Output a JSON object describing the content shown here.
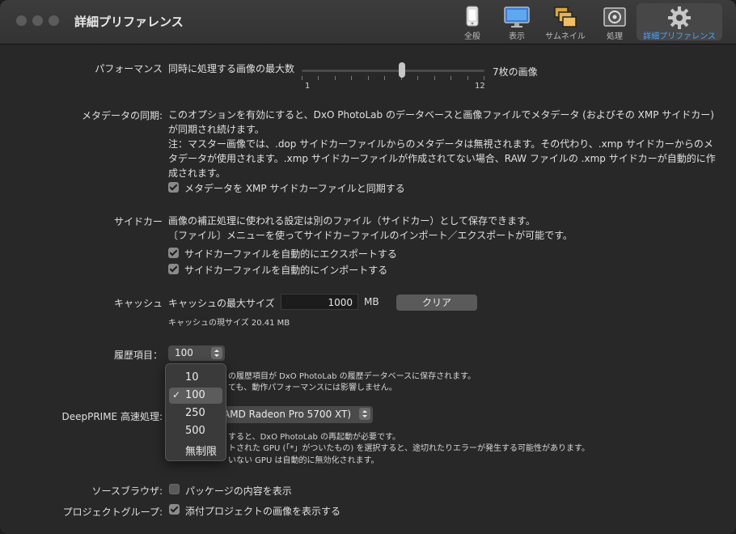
{
  "window": {
    "title": "詳細プリファレンス"
  },
  "toolbar": [
    {
      "label": "全般",
      "icon": "phone-icon"
    },
    {
      "label": "表示",
      "icon": "monitor-icon"
    },
    {
      "label": "サムネイル",
      "icon": "thumbnails-icon"
    },
    {
      "label": "処理",
      "icon": "processing-icon"
    },
    {
      "label": "詳細プリファレンス",
      "icon": "gear-icon",
      "active": true
    }
  ],
  "performance": {
    "label": "パフォーマンス",
    "desc": "同時に処理する画像の最大数",
    "min": "1",
    "max": "12",
    "value": 7,
    "value_text": "7枚の画像"
  },
  "metadata": {
    "label": "メタデータの同期:",
    "line1": "このオプションを有効にすると、DxO PhotoLab のデータベースと画像ファイルでメタデータ (およびその XMP サイドカー)",
    "line2": "が同期され続けます。",
    "note1": "注：マスター画像では、.dop サイドカーファイルからのメタデータは無視されます。その代わり、.xmp サイドカーからのメ",
    "note2": "タデータが使用されます。.xmp サイドカーファイルが作成されてない場合、RAW ファイルの .xmp サイドカーが自動的に作",
    "note3": "成されます。",
    "checkbox": {
      "label": "メタデータを XMP サイドカーファイルと同期する",
      "checked": true
    }
  },
  "sidecar": {
    "label": "サイドカー",
    "line1": "画像の補正処理に使われる設定は別のファイル（サイドカー）として保存できます。",
    "line2": "〔ファイル〕メニューを使ってサイドカ−ファイルのインポート／エクスポートが可能です。",
    "export": {
      "label": "サイドカーファイルを自動的にエクスポートする",
      "checked": true
    },
    "import": {
      "label": "サイドカーファイルを自動的にインポートする",
      "checked": true
    }
  },
  "cache": {
    "label": "キャッシュ",
    "max_label": "キャッシュの最大サイズ",
    "max_value": "1000",
    "unit": "MB",
    "clear_button": "クリア",
    "current": "キャッシュの現サイズ 20.41 MB"
  },
  "history": {
    "label": "履歴項目：",
    "value": "100",
    "desc1": "の履歴項目が DxO PhotoLab の履歴データベースに保存されます。",
    "desc2": "ても、動作パフォーマンスには影響しません。",
    "menu": {
      "options": [
        "10",
        "100",
        "250",
        "500",
        "無制限"
      ],
      "selected": "100"
    }
  },
  "deepprime": {
    "label": "DeepPRIME 高速処理:",
    "value": "AMD Radeon Pro 5700 XT)",
    "desc1": "すると、DxO PhotoLab の再起動が必要です。",
    "desc2": "トされた GPU (「*」がついたもの) を選択すると、途切れたりエラーが発生する可能性があります。",
    "desc3": "いない GPU は自動的に無効化されます。"
  },
  "source_browser": {
    "label": "ソースブラウザ:",
    "checkbox": {
      "label": "パッケージの内容を表示",
      "checked": false
    }
  },
  "project_group": {
    "label": "プロジェクトグループ:",
    "checkbox": {
      "label": "添付プロジェクトの画像を表示する",
      "checked": true
    }
  }
}
